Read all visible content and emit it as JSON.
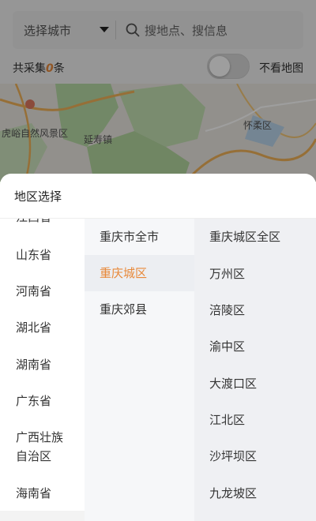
{
  "search": {
    "city_label": "选择城市",
    "placeholder": "搜地点、搜信息"
  },
  "stats": {
    "prefix": "共采集",
    "count": "0",
    "suffix": "条",
    "toggle_label": "不看地图",
    "toggle_on": false
  },
  "map": {
    "labels": [
      "虎峪自然风景区",
      "延寿镇",
      "怀柔区"
    ]
  },
  "sheet": {
    "title": "地区选择",
    "provinces": [
      "江西省",
      "山东省",
      "河南省",
      "湖北省",
      "湖南省",
      "广东省",
      "广西壮族",
      "自治区",
      "海南省"
    ],
    "cities": [
      {
        "label": "重庆市全市",
        "selected": false
      },
      {
        "label": "重庆城区",
        "selected": true
      },
      {
        "label": "重庆郊县",
        "selected": false
      }
    ],
    "districts": [
      "重庆城区全区",
      "万州区",
      "涪陵区",
      "渝中区",
      "大渡口区",
      "江北区",
      "沙坪坝区",
      "九龙坡区"
    ]
  },
  "colors": {
    "accent": "#e8893a",
    "text": "#333333"
  }
}
